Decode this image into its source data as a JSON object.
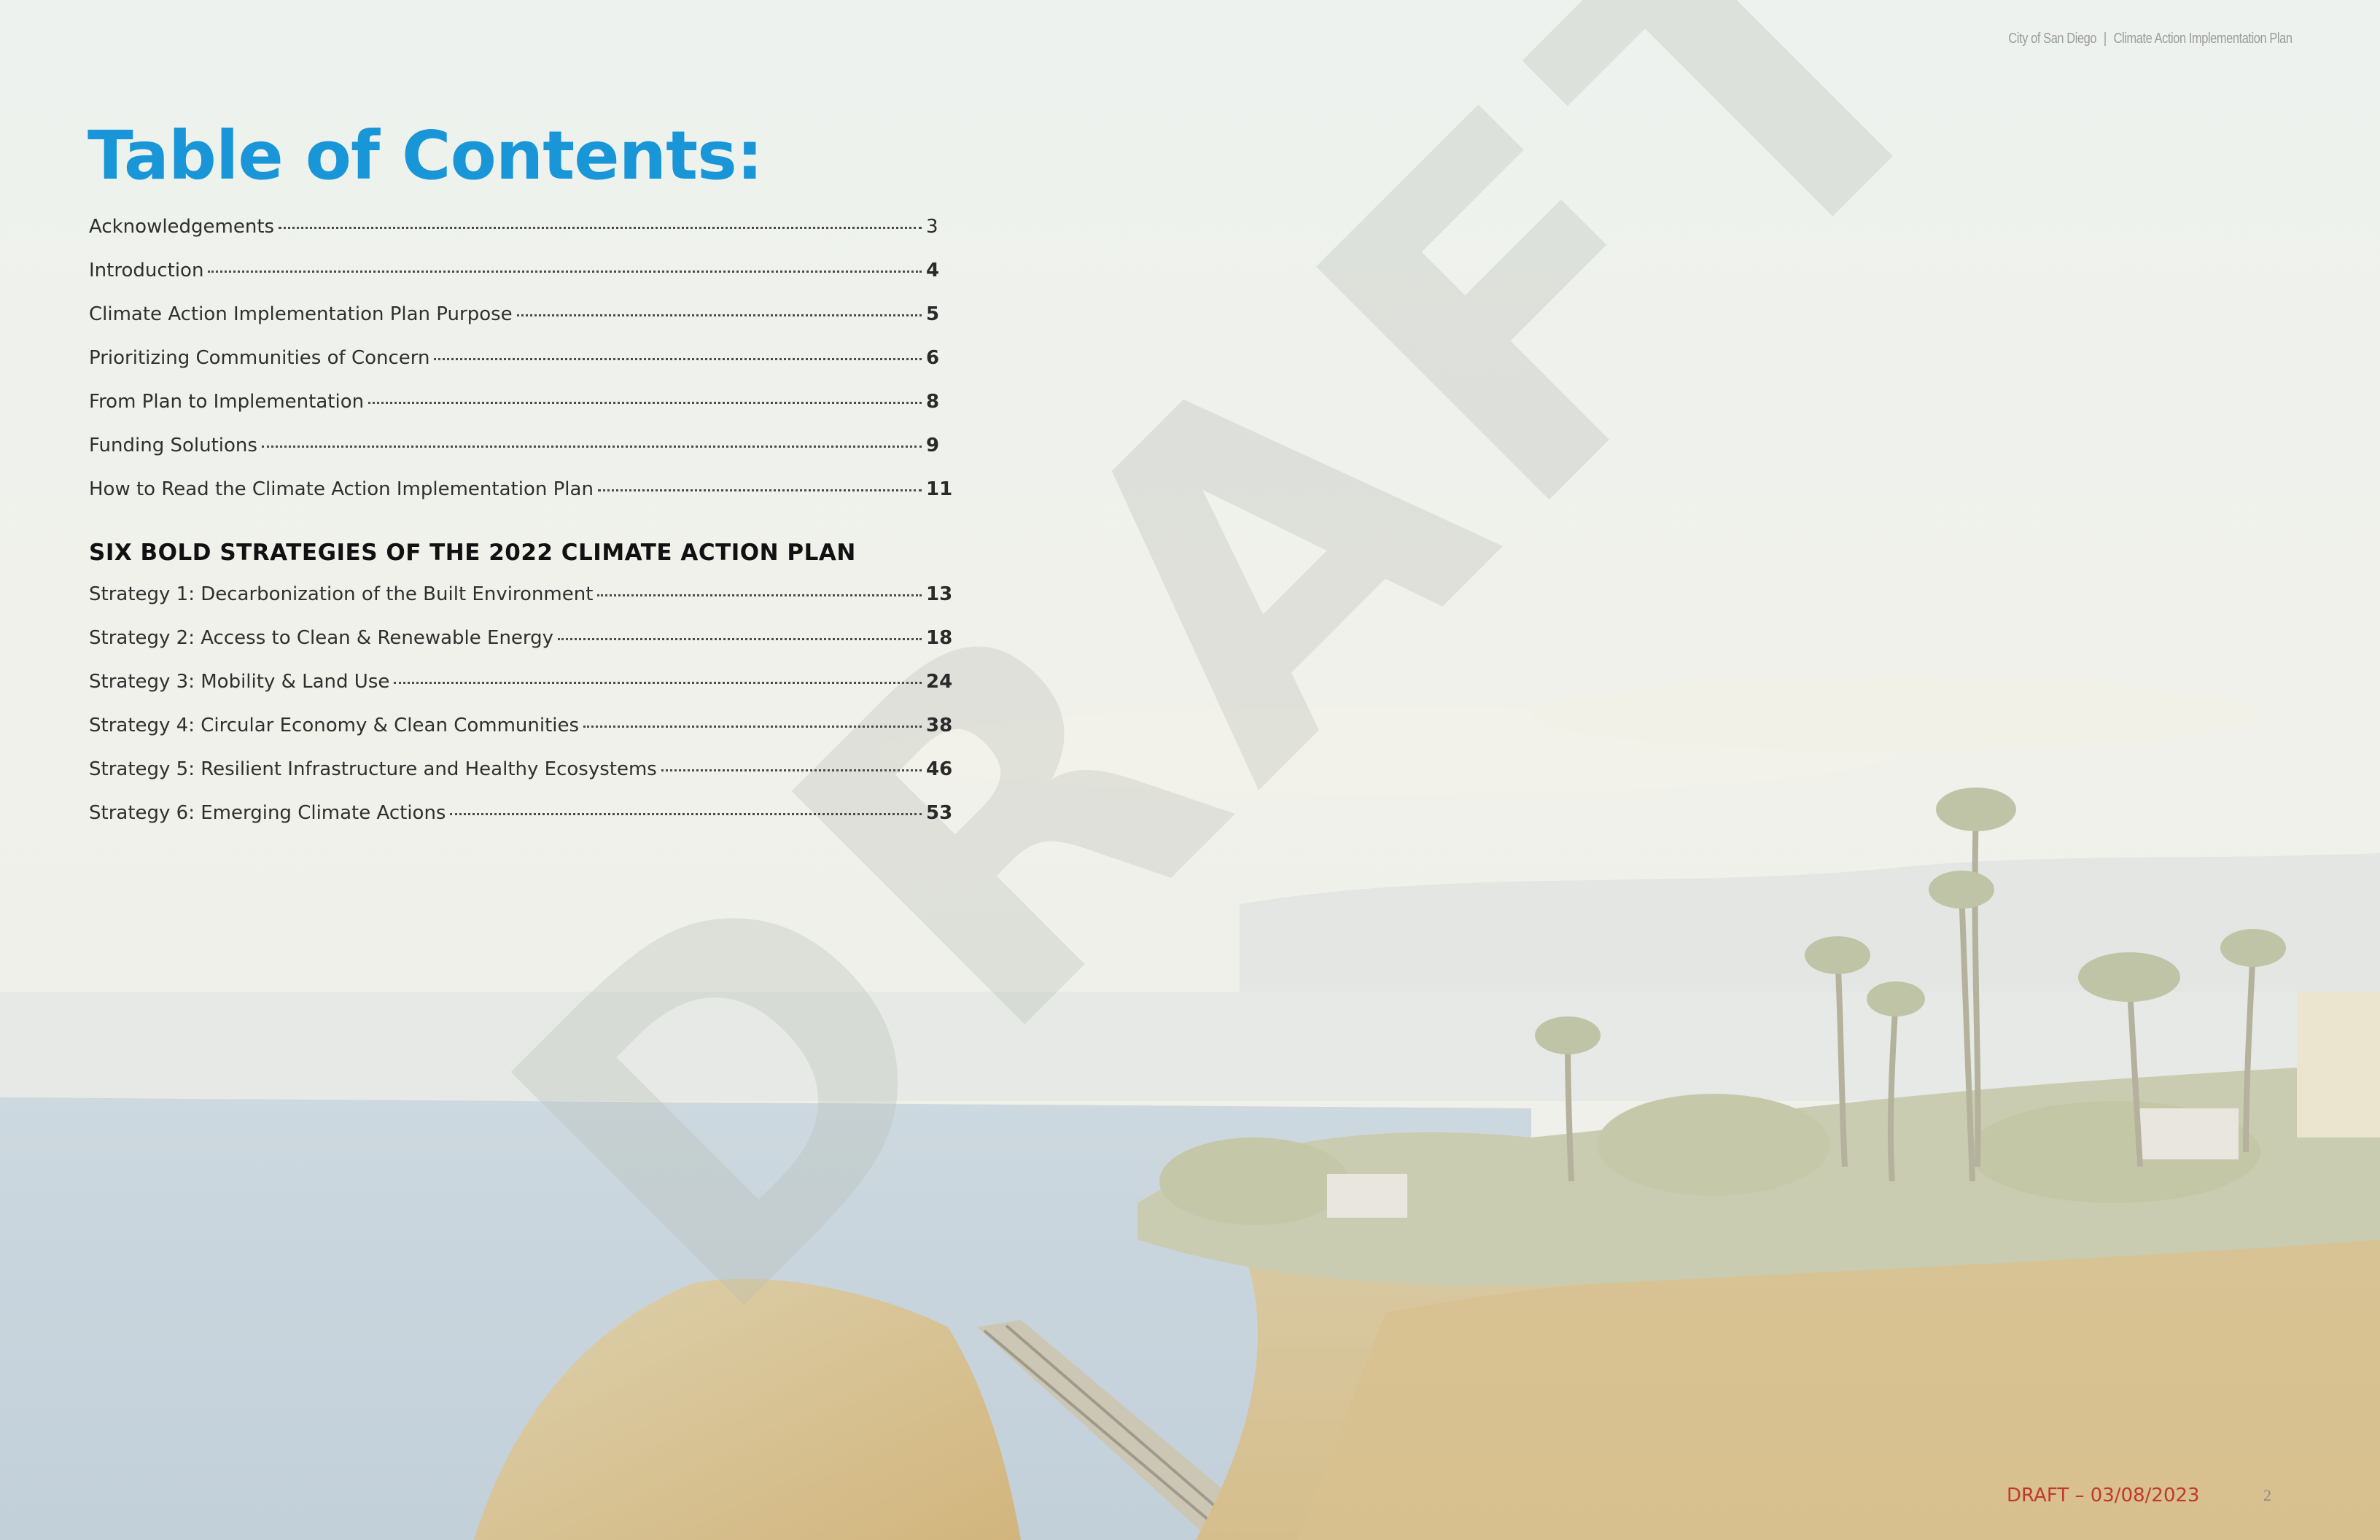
{
  "header": {
    "org": "City of San Diego",
    "separator": "|",
    "doc_title": "Climate Action Implementation Plan"
  },
  "title": "Table of Contents:",
  "watermark": "DRAFT",
  "toc_entries": [
    {
      "label": "Acknowledgements",
      "page": "3"
    },
    {
      "label": "Introduction",
      "page": "4"
    },
    {
      "label": "Climate Action Implementation Plan Purpose",
      "page": "5"
    },
    {
      "label": "Prioritizing Communities of Concern",
      "page": "6"
    },
    {
      "label": "From Plan to Implementation",
      "page": "8"
    },
    {
      "label": "Funding Solutions",
      "page": "9"
    },
    {
      "label": "How to Read the Climate Action Implementation Plan",
      "page": "11"
    }
  ],
  "strategies_heading": "SIX BOLD STRATEGIES OF THE 2022 CLIMATE ACTION PLAN",
  "strategy_entries": [
    {
      "label": "Strategy 1: Decarbonization of the Built Environment",
      "page": "13"
    },
    {
      "label": "Strategy 2: Access to Clean & Renewable Energy",
      "page": "18"
    },
    {
      "label": "Strategy 3: Mobility & Land Use",
      "page": "24"
    },
    {
      "label": "Strategy 4: Circular Economy & Clean Communities",
      "page": "38"
    },
    {
      "label": "Strategy 5: Resilient Infrastructure and Healthy Ecosystems",
      "page": "46"
    },
    {
      "label": "Strategy 6: Emerging Climate Actions",
      "page": "53"
    }
  ],
  "footer": {
    "draft_label": "DRAFT – 03/08/2023",
    "page_number": "2"
  },
  "colors": {
    "title": "#1896d8",
    "draft_footer": "#c0392b",
    "watermark": "#b9bdb5"
  }
}
